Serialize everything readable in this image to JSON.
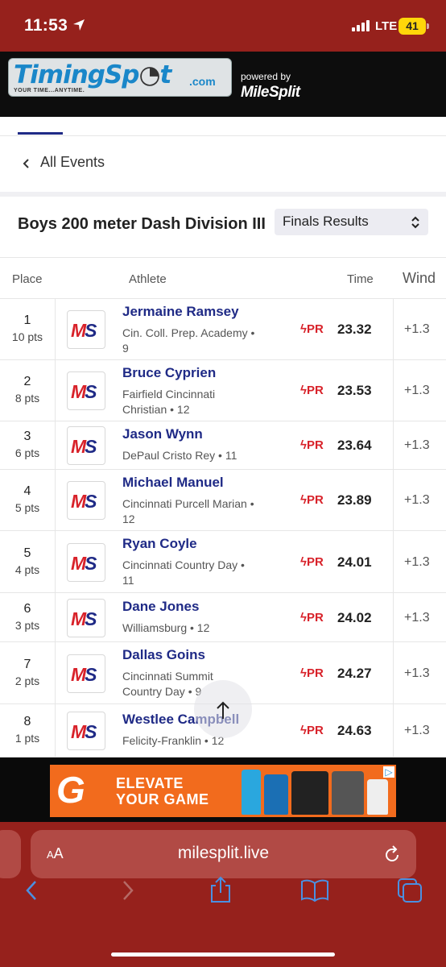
{
  "status_bar": {
    "time": "11:53",
    "network": "LTE",
    "battery": "41"
  },
  "header": {
    "logo_text": "TimingSp",
    "logo_text2": "t",
    "logo_com": ".com",
    "logo_tagline": "YOUR TIME...ANYTIME.",
    "powered_by": "powered by",
    "partner_logo": "MileSplit"
  },
  "nav": {
    "back_label": "All Events"
  },
  "event": {
    "title": "Boys 200 meter Dash Division III",
    "result_type": "Finals Results"
  },
  "table": {
    "headers": {
      "place": "Place",
      "athlete": "Athlete",
      "time": "Time",
      "wind": "Wind"
    },
    "badge_text": {
      "m": "M",
      "s": "S"
    },
    "rows": [
      {
        "place": "1",
        "points": "10 pts",
        "name": "Jermaine Ramsey",
        "school_line1": "Cin. Coll. Prep. Academy •",
        "school_line2": "9",
        "pr": "PR",
        "time": "23.32",
        "wind": "+1.3"
      },
      {
        "place": "2",
        "points": "8 pts",
        "name": "Bruce Cyprien",
        "school_line1": "Fairfield Cincinnati",
        "school_line2": "Christian • 12",
        "pr": "PR",
        "time": "23.53",
        "wind": "+1.3"
      },
      {
        "place": "3",
        "points": "6 pts",
        "name": "Jason Wynn",
        "school_line1": "DePaul Cristo Rey • 11",
        "school_line2": "",
        "pr": "PR",
        "time": "23.64",
        "wind": "+1.3"
      },
      {
        "place": "4",
        "points": "5 pts",
        "name": "Michael Manuel",
        "school_line1": "Cincinnati Purcell Marian •",
        "school_line2": "12",
        "pr": "PR",
        "time": "23.89",
        "wind": "+1.3"
      },
      {
        "place": "5",
        "points": "4 pts",
        "name": "Ryan Coyle",
        "school_line1": "Cincinnati Country Day •",
        "school_line2": "11",
        "pr": "PR",
        "time": "24.01",
        "wind": "+1.3"
      },
      {
        "place": "6",
        "points": "3 pts",
        "name": "Dane Jones",
        "school_line1": "Williamsburg • 12",
        "school_line2": "",
        "pr": "PR",
        "time": "24.02",
        "wind": "+1.3"
      },
      {
        "place": "7",
        "points": "2 pts",
        "name": "Dallas Goins",
        "school_line1": "Cincinnati Summit",
        "school_line2": "Country Day • 9",
        "pr": "PR",
        "time": "24.27",
        "wind": "+1.3"
      },
      {
        "place": "8",
        "points": "1 pts",
        "name": "Westlee Campbell",
        "school_line1": "Felicity-Franklin • 12",
        "school_line2": "",
        "pr": "PR",
        "time": "24.63",
        "wind": "+1.3"
      }
    ]
  },
  "ad": {
    "brand_mark": "G",
    "line1": "ELEVATE",
    "line2": "YOUR GAME"
  },
  "browser": {
    "aa_small": "A",
    "aa_large": "A",
    "url": "milesplit.live"
  },
  "colors": {
    "brand_red": "#96211c",
    "navy": "#1f2a86",
    "pr_red": "#d8222a",
    "ad_orange": "#f26b1d"
  }
}
